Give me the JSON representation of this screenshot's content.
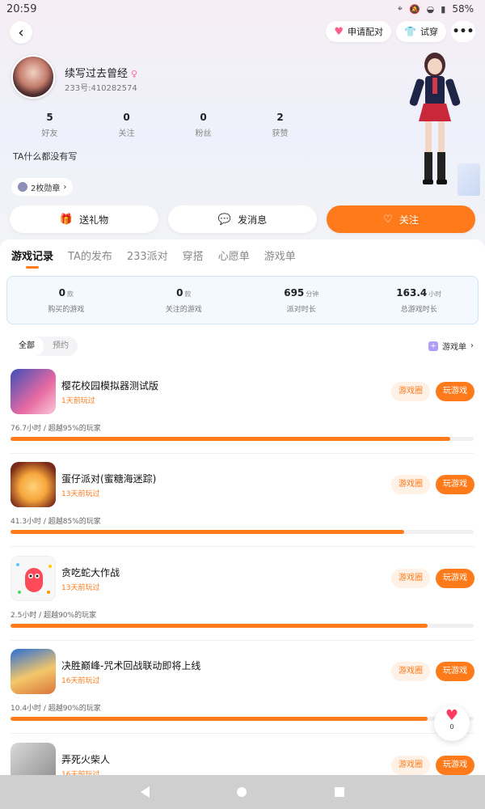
{
  "status_bar": {
    "time": "20:59",
    "battery": "58%"
  },
  "header": {
    "match_button": "申请配对",
    "tryon_button": "试穿",
    "more": "•••"
  },
  "profile": {
    "nickname": "续写过去曾经",
    "uid": "233号:410282574",
    "bio": "TA什么都没有写",
    "badge_chip": "2枚勋章",
    "stats": [
      {
        "value": "5",
        "label": "好友"
      },
      {
        "value": "0",
        "label": "关注"
      },
      {
        "value": "0",
        "label": "粉丝"
      },
      {
        "value": "2",
        "label": "获赞"
      }
    ]
  },
  "actions": {
    "gift": "送礼物",
    "message": "发消息",
    "follow": "关注"
  },
  "tabs": [
    "游戏记录",
    "TA的发布",
    "233派对",
    "穿搭",
    "心愿单",
    "游戏单"
  ],
  "summary": [
    {
      "value": "0",
      "unit": "款",
      "label": "购买的游戏"
    },
    {
      "value": "0",
      "unit": "款",
      "label": "关注的游戏"
    },
    {
      "value": "695",
      "unit": "分钟",
      "label": "派对时长"
    },
    {
      "value": "163.4",
      "unit": "小时",
      "label": "总游戏时长"
    }
  ],
  "filter": {
    "all": "全部",
    "reserve": "预约",
    "gamelist_link": "游戏单"
  },
  "game_buttons": {
    "circle": "游戏圈",
    "play": "玩游戏"
  },
  "games": [
    {
      "name": "樱花校园模拟器测试版",
      "last_played": "1天前玩过",
      "playtime": "76.7小时 / 超越95%的玩家",
      "progress": 0.95
    },
    {
      "name": "蛋仔派对(蜜糖海迷踪)",
      "last_played": "13天前玩过",
      "playtime": "41.3小时 / 超越85%的玩家",
      "progress": 0.85
    },
    {
      "name": "贪吃蛇大作战",
      "last_played": "13天前玩过",
      "playtime": "2.5小时 / 超越90%的玩家",
      "progress": 0.9
    },
    {
      "name": "决胜巅峰-咒术回战联动即将上线",
      "last_played": "16天前玩过",
      "playtime": "10.4小时 / 超越90%的玩家",
      "progress": 0.9
    },
    {
      "name": "弄死火柴人",
      "last_played": "16天前玩过",
      "playtime": "",
      "progress": 0
    }
  ],
  "floating_like": {
    "count": "0"
  },
  "colors": {
    "accent": "#ff7a1a",
    "like": "#ff3b64"
  }
}
